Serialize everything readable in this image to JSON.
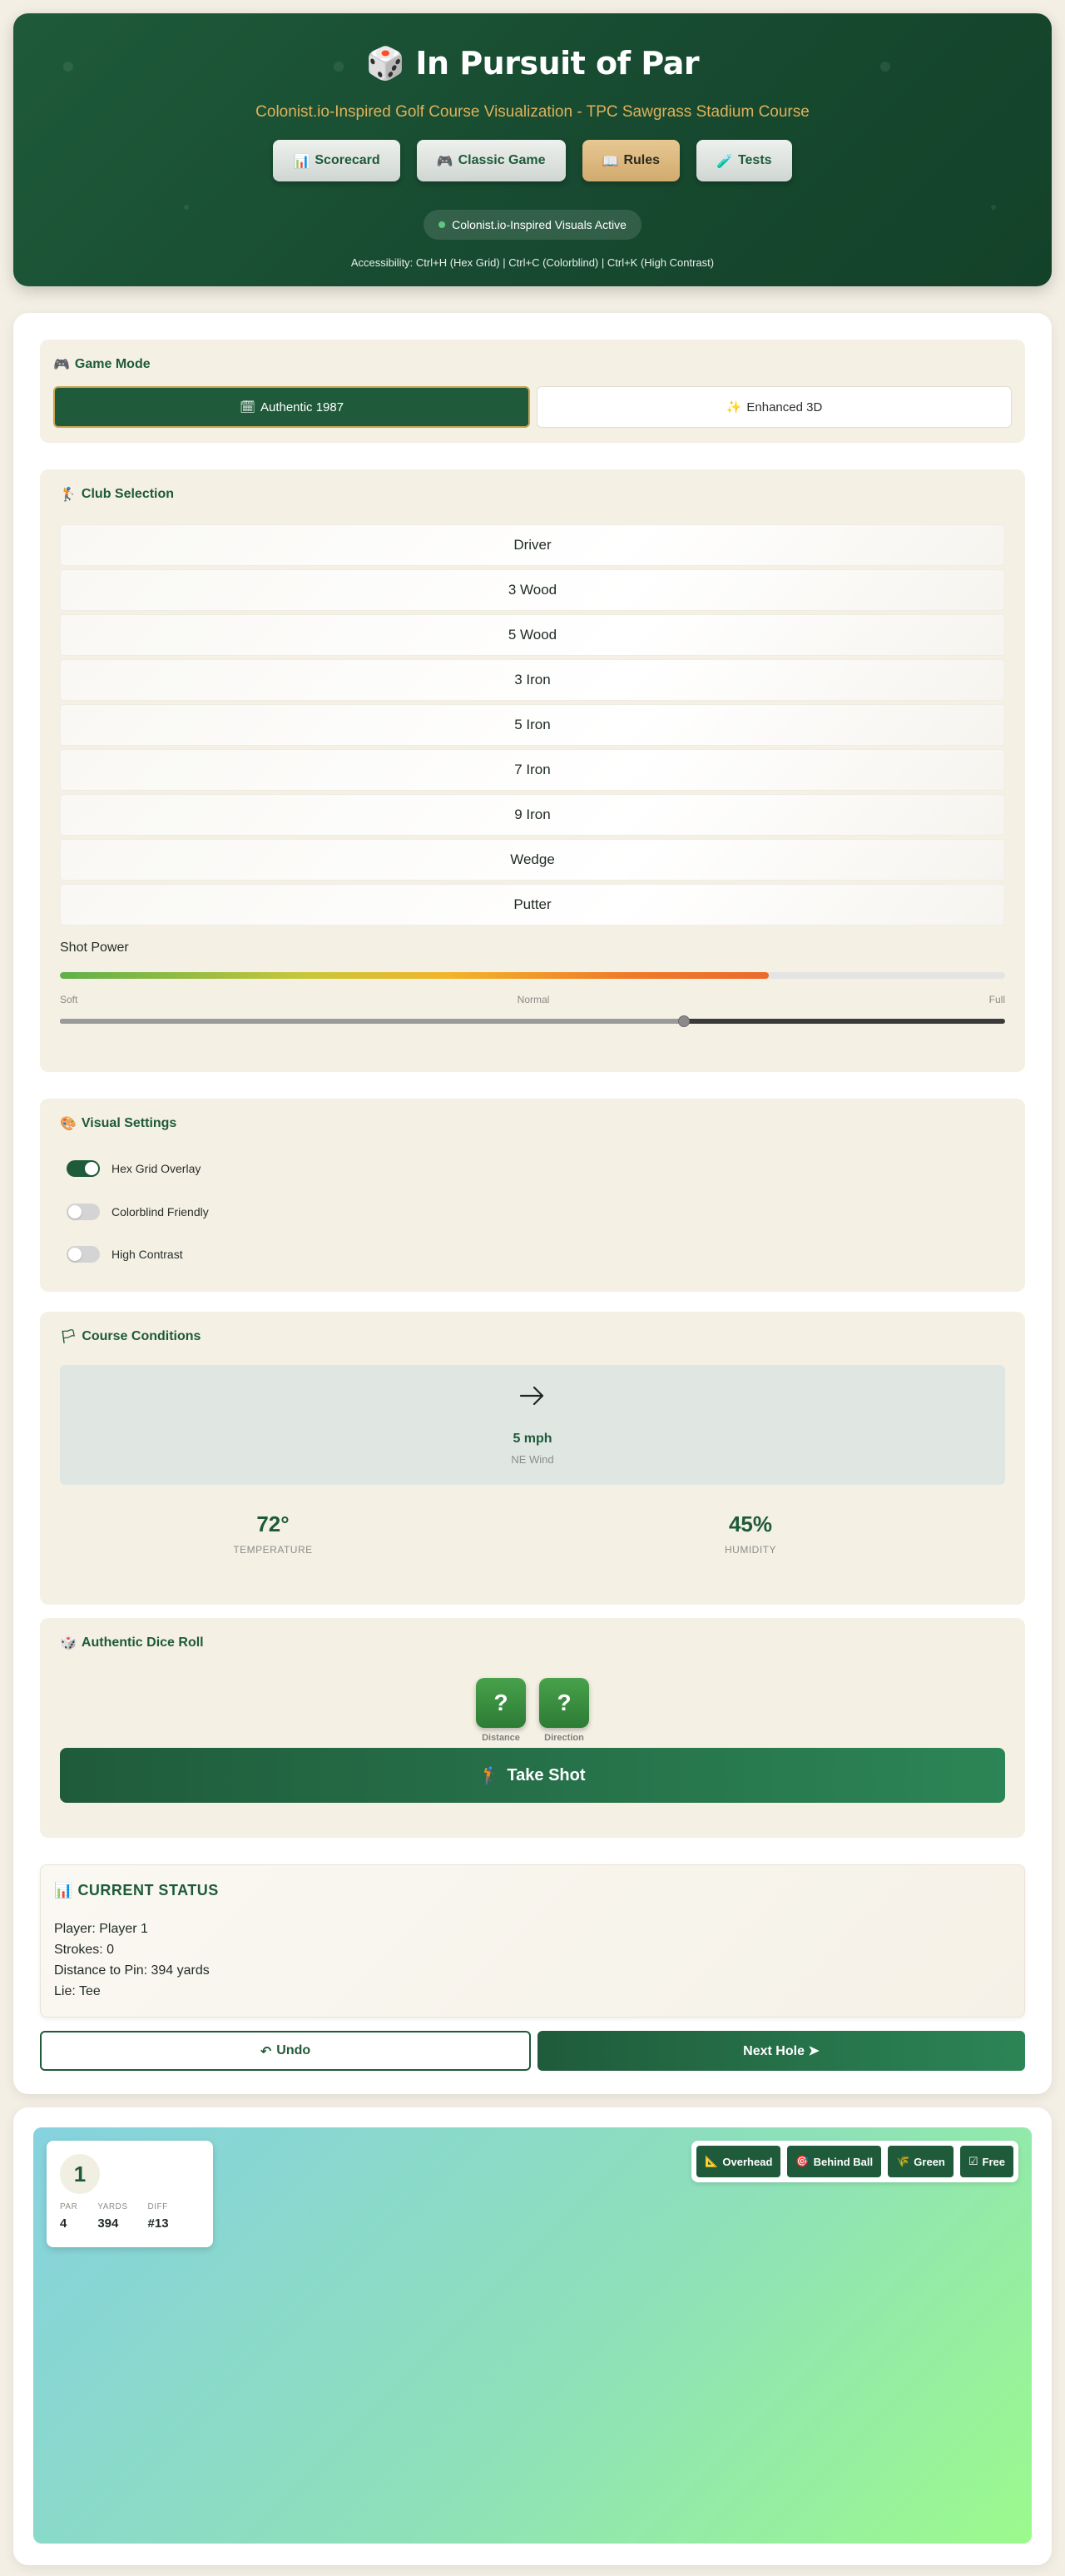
{
  "header": {
    "title_icon": "🎲",
    "title": "In Pursuit of Par",
    "subtitle": "Colonist.io-Inspired Golf Course Visualization - TPC Sawgrass Stadium Course",
    "nav": [
      {
        "icon": "📊",
        "label": "Scorecard"
      },
      {
        "icon": "🎮",
        "label": "Classic Game"
      },
      {
        "icon": "📖",
        "label": "Rules"
      },
      {
        "icon": "🧪",
        "label": "Tests"
      }
    ],
    "status_pill": "Colonist.io-Inspired Visuals Active",
    "accessibility": "Accessibility: Ctrl+H (Hex Grid) | Ctrl+C (Colorblind) | Ctrl+K (High Contrast)"
  },
  "game_mode": {
    "icon": "🎮",
    "title": "Game Mode",
    "options": [
      {
        "icon": "🗓",
        "label": "Authentic 1987",
        "active": true
      },
      {
        "icon": "✨",
        "label": "Enhanced 3D",
        "active": false
      }
    ]
  },
  "clubs": {
    "icon": "🏌",
    "title": "Club Selection",
    "items": [
      "Driver",
      "3 Wood",
      "5 Wood",
      "3 Iron",
      "5 Iron",
      "7 Iron",
      "9 Iron",
      "Wedge",
      "Putter"
    ],
    "power_label": "Shot Power",
    "power_fraction": 0.75,
    "scale": [
      "Soft",
      "Normal",
      "Full"
    ],
    "slider_fraction": 0.66
  },
  "visual_settings": {
    "icon": "🎨",
    "title": "Visual Settings",
    "toggles": [
      {
        "label": "Hex Grid Overlay",
        "on": true
      },
      {
        "label": "Colorblind Friendly",
        "on": false
      },
      {
        "label": "High Contrast",
        "on": false
      }
    ]
  },
  "conditions": {
    "icon": "🏳",
    "title": "Course Conditions",
    "wind_speed": "5 mph",
    "wind_direction": "NE Wind",
    "temperature": "72°",
    "temperature_label": "TEMPERATURE",
    "humidity": "45%",
    "humidity_label": "HUMIDITY"
  },
  "dice": {
    "icon": "🎲",
    "title": "Authentic Dice Roll",
    "dice": [
      {
        "face": "?",
        "label": "Distance"
      },
      {
        "face": "?",
        "label": "Direction"
      }
    ],
    "shot_icon": "🏌",
    "shot_label": "Take Shot"
  },
  "status": {
    "icon": "📊",
    "title": "CURRENT STATUS",
    "lines": [
      "Player: Player 1",
      "Strokes: 0",
      "Distance to Pin: 394 yards",
      "Lie: Tee"
    ]
  },
  "actions": {
    "undo_icon": "↶",
    "undo_label": "Undo",
    "next_label": "Next Hole ➤"
  },
  "hole": {
    "number": "1",
    "par_label": "PAR",
    "par": "4",
    "yards_label": "YARDS",
    "yards": "394",
    "diff_label": "DIFF",
    "diff": "#13"
  },
  "camera": [
    {
      "icon": "📐",
      "label": "Overhead"
    },
    {
      "icon": "🎯",
      "label": "Behind Ball"
    },
    {
      "icon": "🌾",
      "label": "Green"
    },
    {
      "icon": "☑",
      "label": "Free"
    }
  ],
  "colors": {
    "primary_green": "#1f5b3b",
    "gold_accent": "#e0b15a",
    "panel_bg": "#f4f0e4"
  }
}
